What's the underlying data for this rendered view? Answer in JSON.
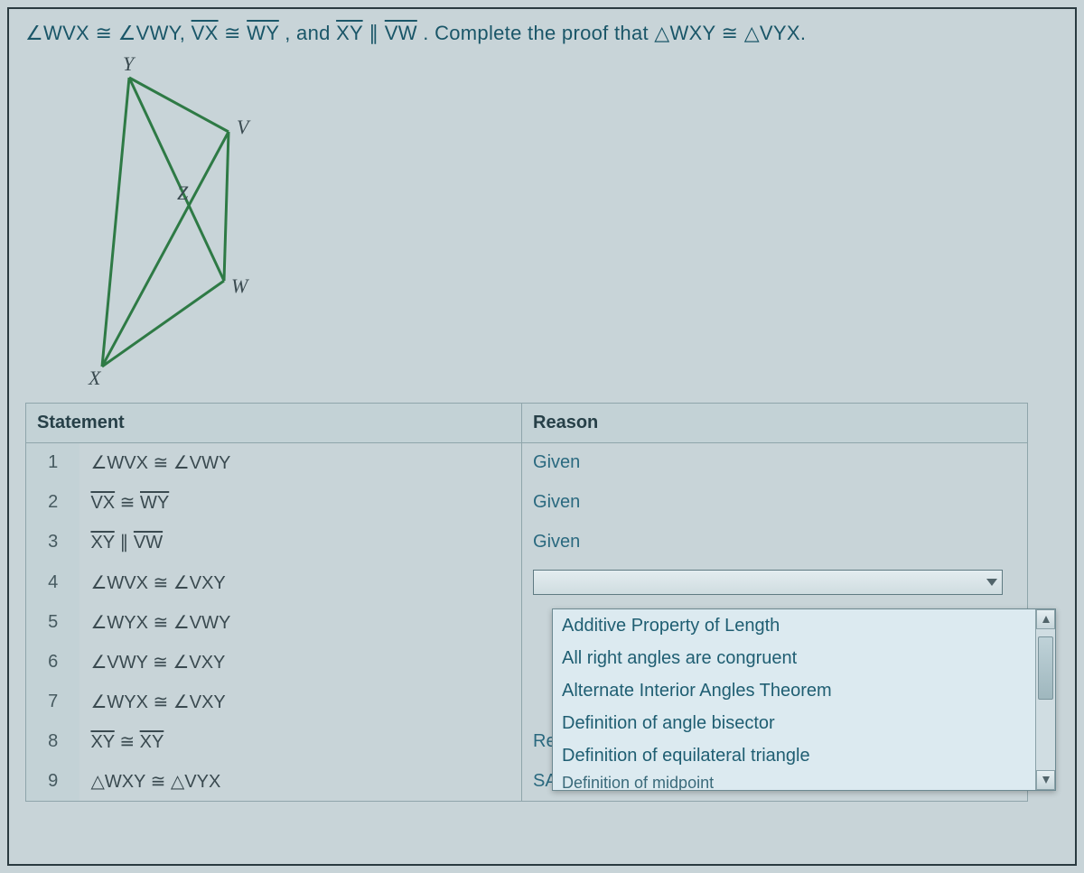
{
  "prompt": {
    "p1": "∠WVX ≅ ∠VWY, ",
    "seg_vx": "VX",
    "cong1": " ≅ ",
    "seg_wy": "WY",
    "p2": ", and ",
    "seg_xy": "XY",
    "par": " ∥ ",
    "seg_vw": "VW",
    "p3": ". Complete the proof that △WXY ≅ △VYX."
  },
  "diagram": {
    "labels": {
      "Y": "Y",
      "V": "V",
      "Z": "Z",
      "W": "W",
      "X": "X"
    }
  },
  "headers": {
    "statement": "Statement",
    "reason": "Reason"
  },
  "rows": [
    {
      "n": "1",
      "stmt_html": "∠WVX ≅ ∠VWY",
      "reason": "Given"
    },
    {
      "n": "2",
      "stmt_html": "<span class='ovl'>VX</span> ≅ <span class='ovl'>WY</span>",
      "reason": "Given"
    },
    {
      "n": "3",
      "stmt_html": "<span class='ovl'>XY</span> ∥ <span class='ovl'>VW</span>",
      "reason": "Given"
    },
    {
      "n": "4",
      "stmt_html": "∠WVX ≅ ∠VXY",
      "reason": ""
    },
    {
      "n": "5",
      "stmt_html": "∠WYX ≅ ∠VWY",
      "reason": ""
    },
    {
      "n": "6",
      "stmt_html": "∠VWY ≅ ∠VXY",
      "reason": ""
    },
    {
      "n": "7",
      "stmt_html": "∠WYX ≅ ∠VXY",
      "reason": ""
    },
    {
      "n": "8",
      "stmt_html": "<span class='ovl'>XY</span> ≅ <span class='ovl'>XY</span>",
      "reason": "Reflexive Property of Congruence"
    },
    {
      "n": "9",
      "stmt_html": "△WXY ≅ △VYX",
      "reason": "SAS"
    }
  ],
  "dropdown": {
    "options": [
      "Additive Property of Length",
      "All right angles are congruent",
      "Alternate Interior Angles Theorem",
      "Definition of angle bisector",
      "Definition of equilateral triangle",
      "Definition of midpoint"
    ]
  }
}
